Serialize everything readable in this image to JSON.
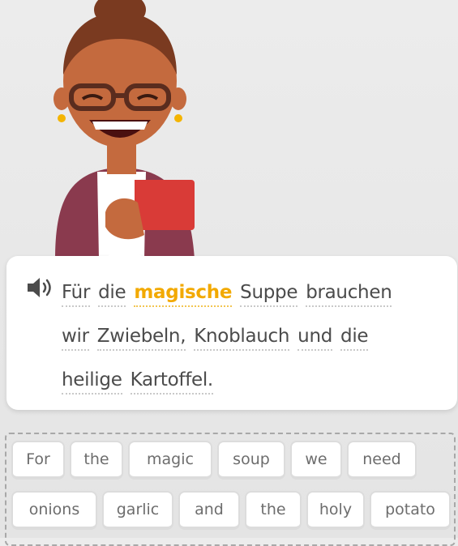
{
  "sentence": {
    "audio_icon": "speaker-icon",
    "highlight_color": "#f2a900",
    "words": [
      {
        "text": "Für",
        "highlight": false
      },
      {
        "text": "die",
        "highlight": false
      },
      {
        "text": "magische",
        "highlight": true
      },
      {
        "text": "Suppe",
        "highlight": false
      },
      {
        "text": "brauchen",
        "highlight": false
      },
      {
        "text": "wir",
        "highlight": false
      },
      {
        "text": "Zwiebeln,",
        "highlight": false
      },
      {
        "text": "Knoblauch",
        "highlight": false
      },
      {
        "text": "und",
        "highlight": false
      },
      {
        "text": "die",
        "highlight": false
      },
      {
        "text": "heilige",
        "highlight": false
      },
      {
        "text": "Kartoffel.",
        "highlight": false
      }
    ]
  },
  "word_bank": {
    "tiles": [
      "For",
      "the",
      "magic",
      "soup",
      "we",
      "need",
      "onions",
      "garlic",
      "and",
      "the",
      "holy",
      "potato"
    ]
  }
}
